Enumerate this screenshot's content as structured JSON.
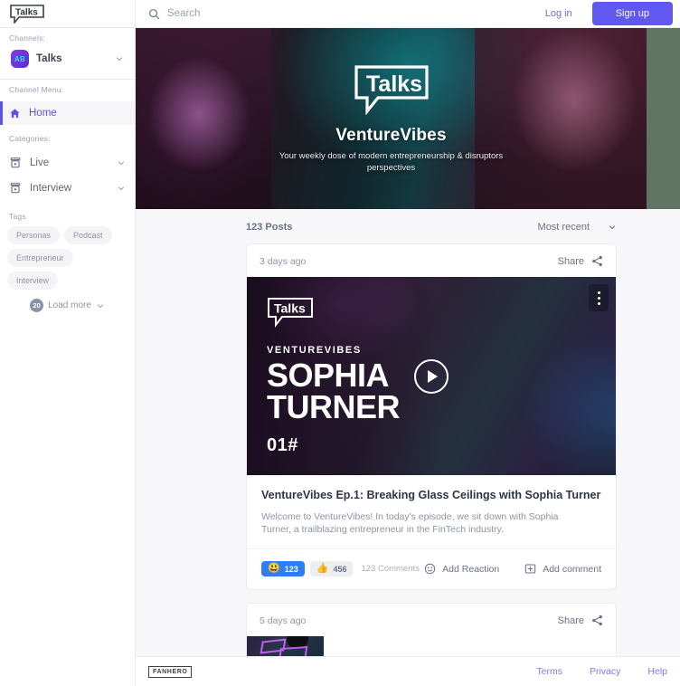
{
  "brand": {
    "logo_text": "Talks",
    "logo_icon": "speech-bubble-icon"
  },
  "sidebar": {
    "channels_label": "Channels:",
    "channel": {
      "initials": "AB",
      "name": "Talks",
      "chevron_icon": "chevron-down-icon"
    },
    "channel_menu_label": "Channel Menu:",
    "menu_items": [
      {
        "label": "Home",
        "icon": "home-icon",
        "active": true
      }
    ],
    "categories_label": "Categories:",
    "categories": [
      {
        "label": "Live",
        "icon": "video-archive-icon",
        "chevron_icon": "chevron-down-icon"
      },
      {
        "label": "Interview",
        "icon": "video-archive-icon",
        "chevron_icon": "chevron-down-icon"
      }
    ],
    "tags_label": "Tags",
    "tags": [
      "Personas",
      "Podcast",
      "Entrepreneur",
      "Interview"
    ],
    "load_more": {
      "count": "20",
      "label": "Load more",
      "chevron_icon": "chevron-down-icon"
    }
  },
  "topbar": {
    "search_icon": "search-icon",
    "search_placeholder": "Search",
    "search_value": "",
    "login_label": "Log in",
    "signup_label": "Sign up"
  },
  "banner": {
    "logo_text": "Talks",
    "title": "VentureVibes",
    "subtitle": "Your weekly dose of modern entrepreneurship & disruptors perspectives",
    "strip_color": "#5f7463"
  },
  "feed": {
    "posts_count": "123 Posts",
    "sort_label": "Most recent",
    "sort_chevron_icon": "chevron-down-icon",
    "posts": [
      {
        "time": "3 days ago",
        "share_label": "Share",
        "share_icon": "share-icon",
        "kebab_icon": "more-vertical-icon",
        "play_icon": "play-icon",
        "thumb": {
          "logo_text": "Talks",
          "show": "VENTUREVIBES",
          "guest_first": "SOPHIA",
          "guest_last": "TURNER",
          "episode": "01#"
        },
        "title": "VentureVibes Ep.1: Breaking Glass Ceilings with Sophia Turner",
        "description": "Welcome to VentureVibes! In today's episode, we sit down with Sophia Turner, a trailblazing entrepreneur in the FinTech industry.",
        "reactions": [
          {
            "emoji": "😃",
            "count": "123",
            "style": "primary"
          },
          {
            "emoji": "👍",
            "count": "456",
            "style": "muted"
          }
        ],
        "comments_label": "123 Comments",
        "add_reaction_label": "Add Reaction",
        "add_reaction_icon": "smiley-icon",
        "add_comment_label": "Add comment",
        "add_comment_icon": "comment-plus-icon"
      },
      {
        "time": "5 days ago",
        "share_label": "Share",
        "share_icon": "share-icon"
      }
    ]
  },
  "footer": {
    "logo_text": "FANHERO",
    "links": [
      "Terms",
      "Privacy",
      "Help"
    ]
  },
  "colors": {
    "accent": "#6058f0",
    "accent_link": "#6f6ae6",
    "reaction_primary": "#2d7ff9",
    "sidebar_active": "#5a53e8",
    "banner_strip": "#5f7463"
  }
}
